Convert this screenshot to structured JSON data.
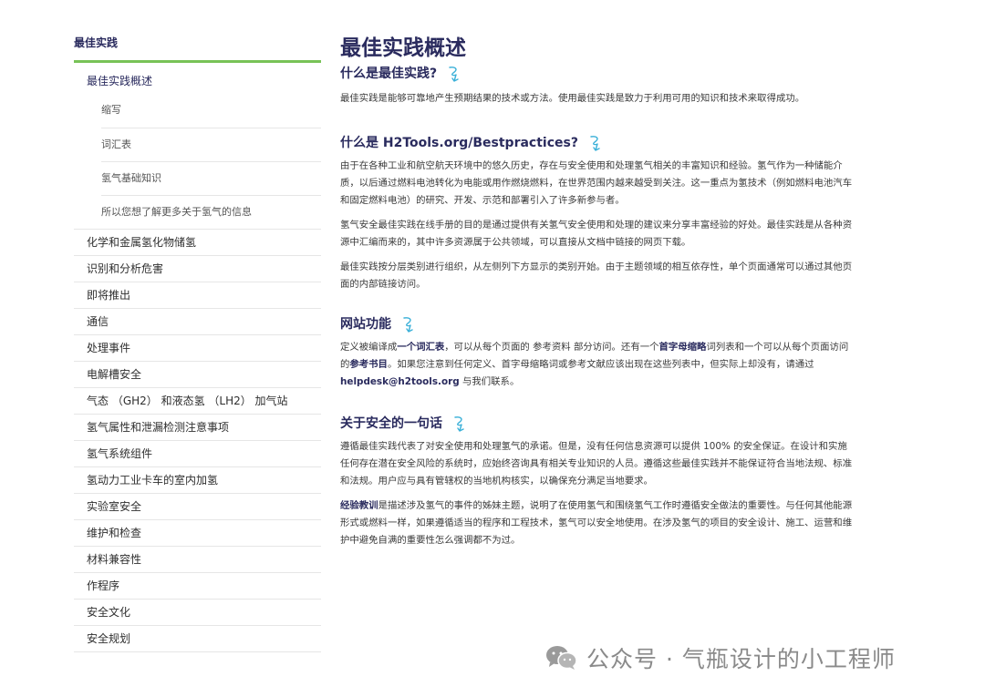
{
  "sidebar": {
    "title": "最佳实践",
    "active": "最佳实践概述",
    "sub": [
      "缩写",
      "词汇表",
      "氢气基础知识",
      "所以您想了解更多关于氢气的信息"
    ],
    "items": [
      "化学和金属氢化物储氢",
      "识别和分析危害",
      "即将推出",
      "通信",
      "处理事件",
      "电解槽安全",
      "气态 （GH2） 和液态氢 （LH2） 加气站",
      "氢气属性和泄漏检测注意事项",
      "氢气系统组件",
      "氢动力工业卡车的室内加氢",
      "实验室安全",
      "维护和检查",
      "材料兼容性",
      "作程序",
      "安全文化",
      "安全规划"
    ]
  },
  "main": {
    "title": "最佳实践概述",
    "s1": {
      "h": "什么是最佳实践?",
      "p1": "最佳实践是能够可靠地产生预期结果的技术或方法。使用最佳实践是致力于利用可用的知识和技术来取得成功。"
    },
    "s2": {
      "h": "什么是 H2Tools.org/Bestpractices?",
      "p1": "由于在各种工业和航空航天环境中的悠久历史，存在与安全使用和处理氢气相关的丰富知识和经验。氢气作为一种储能介质，以后通过燃料电池转化为电能或用作燃烧燃料，在世界范围内越来越受到关注。这一重点为氢技术（例如燃料电池汽车和固定燃料电池）的研究、开发、示范和部署引入了许多新参与者。",
      "p2": "氢气安全最佳实践在线手册的目的是通过提供有关氢气安全使用和处理的建议来分享丰富经验的好处。最佳实践是从各种资源中汇编而来的，其中许多资源属于公共领域，可以直接从文档中链接的网页下载。",
      "p3": "最佳实践按分层类别进行组织，从左侧列下方显示的类别开始。由于主题领域的相互依存性，单个页面通常可以通过其他页面的内部链接访问。"
    },
    "s3": {
      "h": "网站功能",
      "t1": "定义被编译成",
      "l1": "一个词汇表",
      "t2": "，可以从每个页面的 参考资料 部分访问。还有一个",
      "l2": "首字母缩略",
      "t3": "词列表和一个可以从每个页面访问的",
      "l3": "参考书目",
      "t4": "。如果您注意到任何定义、首字母缩略词或参考文献应该出现在这些列表中，但实际上却没有，请通过 ",
      "l4": "helpdesk@h2tools.org",
      "t5": " 与我们联系。"
    },
    "s4": {
      "h": "关于安全的一句话",
      "p1": "遵循最佳实践代表了对安全使用和处理氢气的承诺。但是，没有任何信息资源可以提供 100% 的安全保证。在设计和实施任何存在潜在安全风险的系统时，应始终咨询具有相关专业知识的人员。遵循这些最佳实践并不能保证符合当地法规、标准和法规。用户应与具有管辖权的当地机构核实，以确保充分满足当地要求。",
      "l1": "经验教训",
      "p2": "是描述涉及氢气的事件的姊妹主题，说明了在使用氢气和围绕氢气工作时遵循安全做法的重要性。与任何其他能源形式或燃料一样，如果遵循适当的程序和工程技术，氢气可以安全地使用。在涉及氢气的项目的安全设计、施工、运营和维护中避免自满的重要性怎么强调都不为过。"
    }
  },
  "watermark": {
    "text": "公众号 · 气瓶设计的小工程师"
  },
  "colors": {
    "accent": "#78c257",
    "heading": "#2a2b5e",
    "squiggle": "#3ab0d8"
  }
}
